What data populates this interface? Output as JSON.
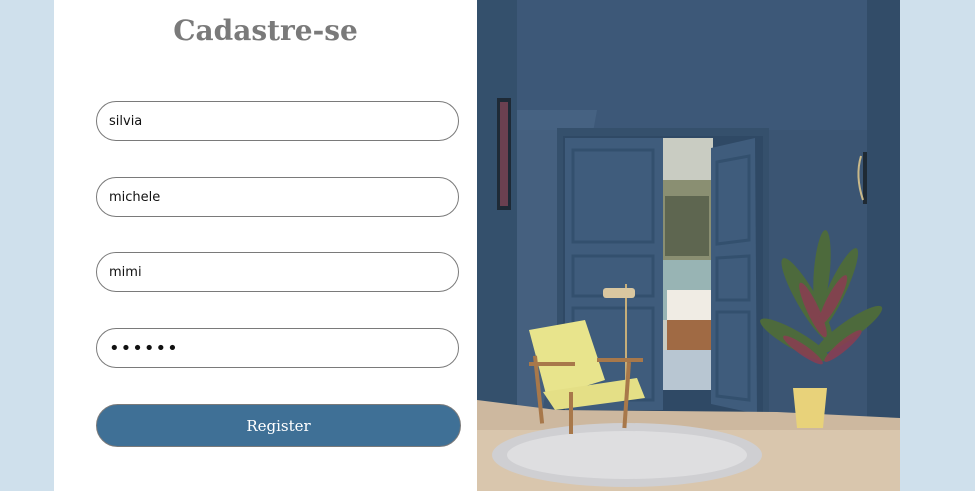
{
  "form": {
    "title": "Cadastre-se",
    "fields": [
      {
        "name": "first-name",
        "value": "silvia",
        "type": "text"
      },
      {
        "name": "last-name",
        "value": "michele",
        "type": "text"
      },
      {
        "name": "username",
        "value": "mimi",
        "type": "text"
      },
      {
        "name": "password",
        "value": "mimimi",
        "type": "password"
      }
    ],
    "register_label": "Register"
  },
  "colors": {
    "page_background": "#cfe0ec",
    "button": "#3f7096",
    "wall": "#3b5573",
    "chair": "#e8e48c"
  },
  "photo": {
    "subject": "interior-room-image"
  }
}
